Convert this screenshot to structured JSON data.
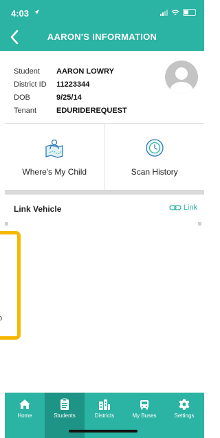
{
  "status": {
    "time": "4:03"
  },
  "nav": {
    "title": "AARON'S INFORMATION"
  },
  "student_info": {
    "rows": [
      {
        "label": "Student",
        "value": "AARON LOWRY"
      },
      {
        "label": "District ID",
        "value": "11223344"
      },
      {
        "label": "DOB",
        "value": "9/25/14"
      },
      {
        "label": "Tenant",
        "value": "EDURIDEREQUEST"
      }
    ]
  },
  "actions": {
    "wheres_my_child": "Where's My Child",
    "scan_history": "Scan History"
  },
  "link_vehicle": {
    "title": "Link Vehicle",
    "link_label": "Link"
  },
  "highlight_text": "o",
  "tabs": [
    {
      "label": "Home",
      "icon": "home-icon",
      "active": false
    },
    {
      "label": "Students",
      "icon": "students-icon",
      "active": true
    },
    {
      "label": "Districts",
      "icon": "districts-icon",
      "active": false
    },
    {
      "label": "My Buses",
      "icon": "bus-icon",
      "active": false
    },
    {
      "label": "Settings",
      "icon": "gear-icon",
      "active": false
    }
  ],
  "colors": {
    "primary": "#2bb3a3",
    "active_tab": "#1d9486",
    "highlight": "#f5b700"
  }
}
